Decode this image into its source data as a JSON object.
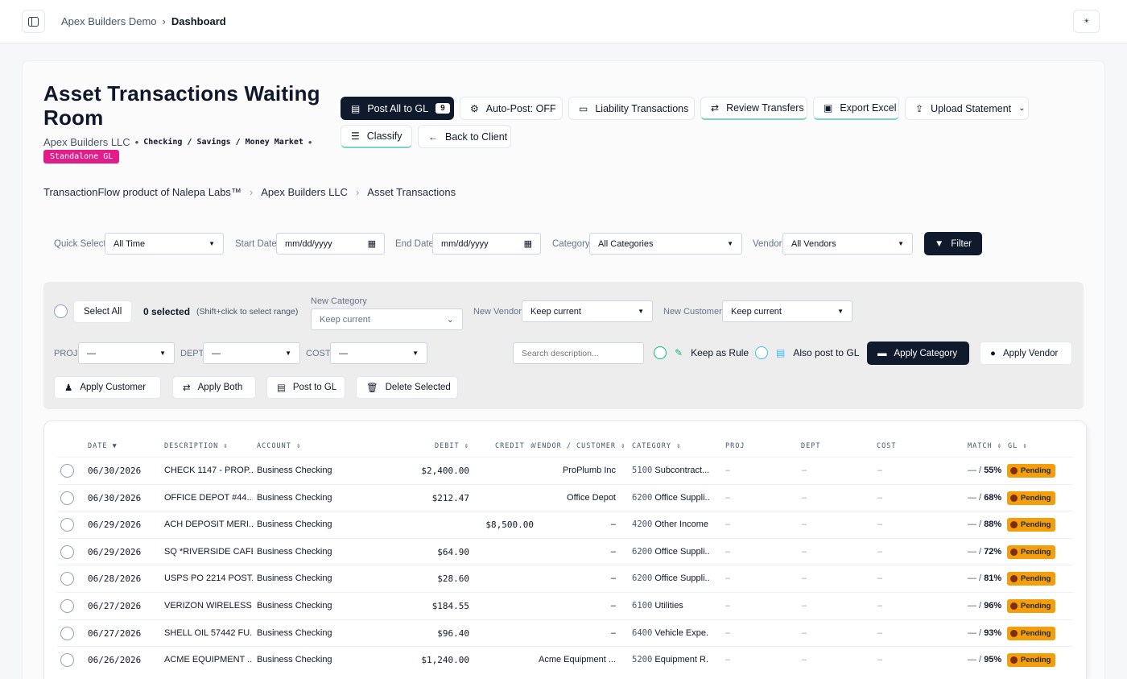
{
  "topbar": {
    "breadcrumb_root": "Apex Builders Demo",
    "breadcrumb_sep": "›",
    "breadcrumb_current": "Dashboard",
    "theme_glyph": "☀"
  },
  "header": {
    "title": "Asset Transactions Waiting Room",
    "client": "Apex Builders LLC",
    "dot": "•",
    "account_types": "Checking / Savings / Money Market",
    "badge": "Standalone GL"
  },
  "actions": {
    "post_all": "Post All to GL",
    "post_all_count": "9",
    "auto_post": "Auto-Post: OFF",
    "liability": "Liability Transactions",
    "review_transfers": "Review Transfers",
    "export_excel": "Export Excel",
    "upload_statement": "Upload Statement",
    "classify": "Classify",
    "back": "Back to Client"
  },
  "breadcrumb": {
    "items": [
      "TransactionFlow product of Nalepa Labs™",
      "Apex Builders LLC",
      "Asset Transactions"
    ],
    "sep": "›"
  },
  "filters": {
    "quick_select_label": "Quick Select",
    "quick_select_value": "All Time",
    "start_label": "Start Date",
    "start_placeholder": "mm/dd/yyyy",
    "end_label": "End Date",
    "end_placeholder": "mm/dd/yyyy",
    "category_label": "Category",
    "category_value": "All Categories",
    "vendor_label": "Vendor",
    "vendor_value": "All Vendors",
    "filter_button": "Filter"
  },
  "bulk": {
    "select_all": "Select All",
    "selected": "0 selected",
    "hint": "(Shift+click to select range)",
    "new_category_label": "New Category",
    "new_category_value": "Keep current",
    "new_vendor_label": "New Vendor",
    "new_vendor_value": "Keep current",
    "new_customer_label": "New Customer",
    "new_customer_value": "Keep current",
    "proj_label": "PROJ",
    "proj_value": "—",
    "dept_label": "DEPT",
    "dept_value": "—",
    "cost_label": "COST",
    "cost_value": "—",
    "search_placeholder": "Search description...",
    "keep_rule": "Keep as Rule",
    "also_post": "Also post to GL",
    "apply_category": "Apply Category",
    "apply_vendor": "Apply Vendor",
    "apply_customer": "Apply Customer",
    "apply_both": "Apply Both",
    "post_gl": "Post to GL",
    "delete_selected": "Delete Selected"
  },
  "table": {
    "headers": {
      "date": "DATE",
      "description": "DESCRIPTION",
      "account": "ACCOUNT",
      "debit": "DEBIT",
      "credit": "CREDIT",
      "vendor": "VENDOR / CUSTOMER",
      "category": "CATEGORY",
      "proj": "PROJ",
      "dept": "DEPT",
      "cost": "COST",
      "match": "MATCH",
      "gl": "GL"
    },
    "rows": [
      {
        "date": "06/30/2026",
        "desc": "CHECK 1147 - PROP...",
        "account": "Business Checking",
        "debit": "$2,400.00",
        "credit": "",
        "vendor": "ProPlumb Inc",
        "code": "5100",
        "category": "Subcontract...",
        "proj": "–",
        "dept": "–",
        "cost": "–",
        "match_prefix": "— /",
        "match": "55%",
        "gl": "Pending"
      },
      {
        "date": "06/30/2026",
        "desc": "OFFICE DEPOT #44...",
        "account": "Business Checking",
        "debit": "$212.47",
        "credit": "",
        "vendor": "Office Depot",
        "code": "6200",
        "category": "Office Suppli...",
        "proj": "–",
        "dept": "–",
        "cost": "–",
        "match_prefix": "— /",
        "match": "68%",
        "gl": "Pending"
      },
      {
        "date": "06/29/2026",
        "desc": "ACH DEPOSIT MERI...",
        "account": "Business Checking",
        "debit": "",
        "credit": "$8,500.00",
        "vendor": "–",
        "code": "4200",
        "category": "Other Income",
        "proj": "–",
        "dept": "–",
        "cost": "–",
        "match_prefix": "— /",
        "match": "88%",
        "gl": "Pending"
      },
      {
        "date": "06/29/2026",
        "desc": "SQ *RIVERSIDE CAFE",
        "account": "Business Checking",
        "debit": "$64.90",
        "credit": "",
        "vendor": "–",
        "code": "6200",
        "category": "Office Suppli...",
        "proj": "–",
        "dept": "–",
        "cost": "–",
        "match_prefix": "— /",
        "match": "72%",
        "gl": "Pending"
      },
      {
        "date": "06/28/2026",
        "desc": "USPS PO 2214 POST...",
        "account": "Business Checking",
        "debit": "$28.60",
        "credit": "",
        "vendor": "–",
        "code": "6200",
        "category": "Office Suppli...",
        "proj": "–",
        "dept": "–",
        "cost": "–",
        "match_prefix": "— /",
        "match": "81%",
        "gl": "Pending"
      },
      {
        "date": "06/27/2026",
        "desc": "VERIZON WIRELESS ...",
        "account": "Business Checking",
        "debit": "$184.55",
        "credit": "",
        "vendor": "–",
        "code": "6100",
        "category": "Utilities",
        "proj": "–",
        "dept": "–",
        "cost": "–",
        "match_prefix": "— /",
        "match": "96%",
        "gl": "Pending"
      },
      {
        "date": "06/27/2026",
        "desc": "SHELL OIL 57442 FU...",
        "account": "Business Checking",
        "debit": "$96.40",
        "credit": "",
        "vendor": "–",
        "code": "6400",
        "category": "Vehicle Expe...",
        "proj": "–",
        "dept": "–",
        "cost": "–",
        "match_prefix": "— /",
        "match": "93%",
        "gl": "Pending"
      },
      {
        "date": "06/26/2026",
        "desc": "ACME EQUIPMENT ...",
        "account": "Business Checking",
        "debit": "$1,240.00",
        "credit": "",
        "vendor": "Acme Equipment ...",
        "code": "5200",
        "category": "Equipment R...",
        "proj": "–",
        "dept": "–",
        "cost": "–",
        "match_prefix": "— /",
        "match": "95%",
        "gl": "Pending"
      }
    ]
  },
  "colors": {
    "primary_dark": "#0f1b2d",
    "badge_pink": "#e11d8a",
    "pending_amber": "#f59e0b",
    "rule_green": "#10b981",
    "gl_blue": "#38bdf8"
  }
}
